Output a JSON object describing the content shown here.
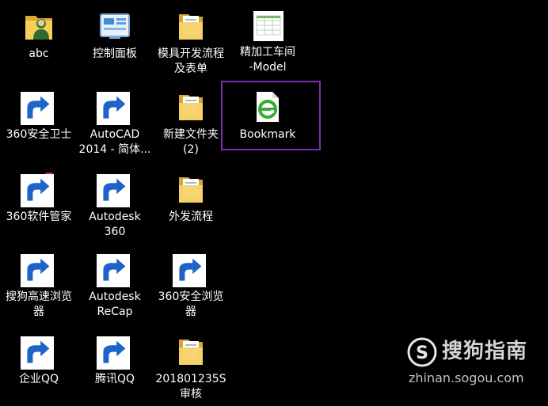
{
  "desktop": {
    "selected_icon": "Bookmark",
    "icons": [
      {
        "label": "abc",
        "icon": "user-folder-icon"
      },
      {
        "label": "控制面板",
        "icon": "control-panel-icon"
      },
      {
        "label": "模具开发流程\n及表单",
        "icon": "folder-icon"
      },
      {
        "label": "精加工车间\n-Model",
        "icon": "spreadsheet-file-icon"
      },
      {
        "label": "360安全卫士",
        "icon": "360-safe-guard-icon"
      },
      {
        "label": "AutoCAD\n2014 - 简体...",
        "icon": "autocad-icon"
      },
      {
        "label": "新建文件夹\n(2)",
        "icon": "folder-icon"
      },
      {
        "label": "Bookmark",
        "icon": "ie-html-file-icon"
      },
      {
        "label": "360软件管家",
        "icon": "360-software-manager-icon"
      },
      {
        "label": "Autodesk\n360",
        "icon": "autodesk-360-icon"
      },
      {
        "label": "外发流程",
        "icon": "folder-icon"
      },
      {
        "label": "搜狗高速浏览\n器",
        "icon": "sogou-browser-icon"
      },
      {
        "label": "Autodesk\nReCap",
        "icon": "autodesk-recap-icon"
      },
      {
        "label": "360安全浏览\n器",
        "icon": "360-browser-icon"
      },
      {
        "label": "企业QQ",
        "icon": "enterprise-qq-icon"
      },
      {
        "label": "腾讯QQ",
        "icon": "qq-penguin-icon"
      },
      {
        "label": "201801235S\n审核",
        "icon": "folder-icon"
      }
    ]
  },
  "watermark": {
    "title": "搜狗指南",
    "url": "zhinan.sogou.com",
    "logo_letter": "S",
    "icon": "sogou-logo-icon"
  },
  "colors": {
    "background": "#000000",
    "selection_border": "#7b2fb0",
    "label_text": "#ffffff",
    "folder": "#f2c94c",
    "ie_green": "#3aaa35",
    "autocad_red": "#c8102e",
    "autodesk_blue": "#1e6fb8"
  }
}
